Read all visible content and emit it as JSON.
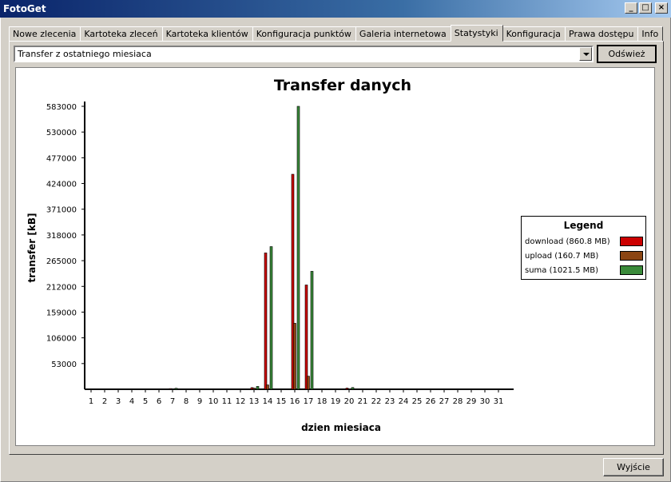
{
  "window": {
    "title": "FotoGet"
  },
  "tabs": [
    {
      "label": "Nowe zlecenia"
    },
    {
      "label": "Kartoteka zleceń"
    },
    {
      "label": "Kartoteka klientów"
    },
    {
      "label": "Konfiguracja punktów"
    },
    {
      "label": "Galeria internetowa"
    },
    {
      "label": "Statystyki",
      "active": true
    },
    {
      "label": "Konfiguracja"
    },
    {
      "label": "Prawa dostępu"
    },
    {
      "label": "Info"
    }
  ],
  "controls": {
    "period_select": "Transfer z ostatniego miesiaca",
    "refresh_label": "Odśwież",
    "exit_label": "Wyjście"
  },
  "chart_data": {
    "type": "bar",
    "title": "Transfer danych",
    "xlabel": "dzien miesiaca",
    "ylabel": "transfer [kB]",
    "ylim": [
      0,
      583000
    ],
    "yticks": [
      53000,
      106000,
      159000,
      212000,
      265000,
      318000,
      371000,
      424000,
      477000,
      530000,
      583000
    ],
    "categories": [
      "1",
      "2",
      "3",
      "4",
      "5",
      "6",
      "7",
      "8",
      "9",
      "10",
      "11",
      "12",
      "13",
      "14",
      "15",
      "16",
      "17",
      "18",
      "19",
      "20",
      "21",
      "22",
      "23",
      "24",
      "25",
      "26",
      "27",
      "28",
      "29",
      "30",
      "31"
    ],
    "series": [
      {
        "name": "download (860.8 MB)",
        "color": "#cc0000",
        "values": [
          0,
          0,
          0,
          0,
          0,
          0,
          1500,
          0,
          0,
          0,
          0,
          0,
          3500,
          281000,
          0,
          443000,
          215000,
          0,
          0,
          2500,
          0,
          0,
          0,
          0,
          0,
          0,
          0,
          0,
          0,
          0,
          0
        ]
      },
      {
        "name": "upload (160.7 MB)",
        "color": "#8b4513",
        "values": [
          0,
          0,
          0,
          0,
          0,
          0,
          700,
          0,
          0,
          0,
          0,
          0,
          2500,
          9000,
          0,
          136000,
          27000,
          0,
          0,
          1200,
          0,
          0,
          0,
          0,
          0,
          0,
          0,
          0,
          0,
          0,
          0
        ]
      },
      {
        "name": "suma (1021.5 MB)",
        "color": "#3a8a3a",
        "values": [
          0,
          0,
          0,
          0,
          0,
          0,
          2200,
          0,
          0,
          0,
          0,
          0,
          6000,
          294000,
          0,
          583000,
          243000,
          0,
          0,
          3700,
          0,
          0,
          0,
          0,
          0,
          0,
          0,
          0,
          0,
          0,
          0
        ]
      }
    ],
    "legend": {
      "title": "Legend",
      "position": "right"
    }
  }
}
